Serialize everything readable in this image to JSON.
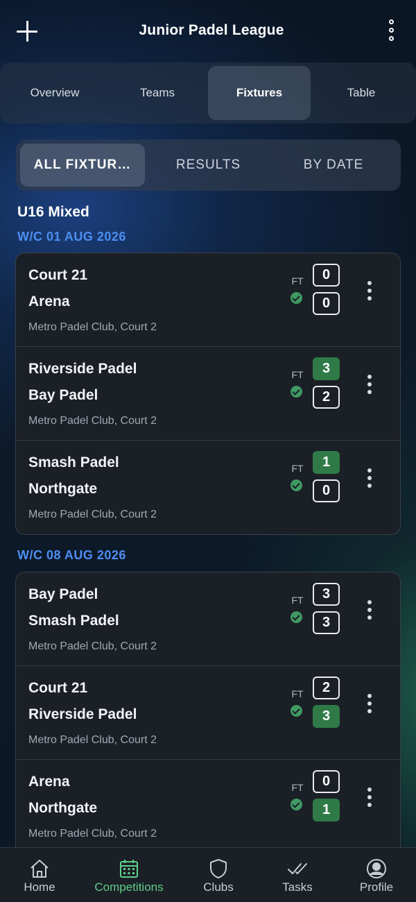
{
  "header": {
    "title": "Junior Padel League"
  },
  "tabs": [
    {
      "label": "Overview"
    },
    {
      "label": "Teams"
    },
    {
      "label": "Fixtures",
      "active": true
    },
    {
      "label": "Table"
    }
  ],
  "filters": [
    {
      "label": "ALL FIXTUR…",
      "active": true
    },
    {
      "label": "RESULTS"
    },
    {
      "label": "BY DATE"
    }
  ],
  "group": {
    "title": "U16 Mixed"
  },
  "weeks": [
    {
      "label": "W/C 01 AUG 2026",
      "fixtures": [
        {
          "home": "Court 21",
          "away": "Arena",
          "venue": "Metro Padel Club, Court 2",
          "status": "FT",
          "home_score": "0",
          "away_score": "0",
          "winner": "none"
        },
        {
          "home": "Riverside Padel",
          "away": "Bay Padel",
          "venue": "Metro Padel Club, Court 2",
          "status": "FT",
          "home_score": "3",
          "away_score": "2",
          "winner": "home"
        },
        {
          "home": "Smash Padel",
          "away": "Northgate",
          "venue": "Metro Padel Club, Court 2",
          "status": "FT",
          "home_score": "1",
          "away_score": "0",
          "winner": "home"
        }
      ]
    },
    {
      "label": "W/C 08 AUG 2026",
      "fixtures": [
        {
          "home": "Bay Padel",
          "away": "Smash Padel",
          "venue": "Metro Padel Club, Court 2",
          "status": "FT",
          "home_score": "3",
          "away_score": "3",
          "winner": "none"
        },
        {
          "home": "Court 21",
          "away": "Riverside Padel",
          "venue": "Metro Padel Club, Court 2",
          "status": "FT",
          "home_score": "2",
          "away_score": "3",
          "winner": "away"
        },
        {
          "home": "Arena",
          "away": "Northgate",
          "venue": "Metro Padel Club, Court 2",
          "status": "FT",
          "home_score": "0",
          "away_score": "1",
          "winner": "away"
        }
      ]
    }
  ],
  "bottom_nav": [
    {
      "label": "Home",
      "icon": "home-icon"
    },
    {
      "label": "Competitions",
      "icon": "calendar-icon",
      "active": true
    },
    {
      "label": "Clubs",
      "icon": "shield-icon"
    },
    {
      "label": "Tasks",
      "icon": "double-check-icon"
    },
    {
      "label": "Profile",
      "icon": "user-circle-icon"
    }
  ],
  "colors": {
    "accent_blue": "#4d8ef2",
    "win_green": "#2f7a47",
    "nav_active": "#5fcf8b",
    "check_green": "#3f9a63"
  }
}
